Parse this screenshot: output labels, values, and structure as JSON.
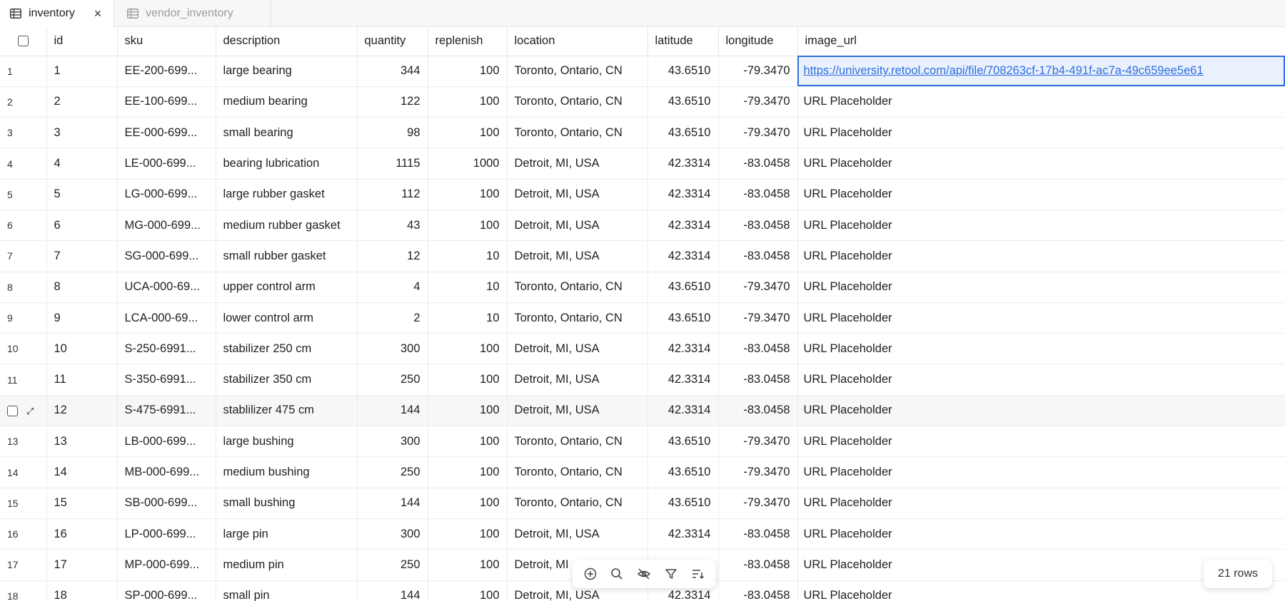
{
  "tabs": [
    {
      "label": "inventory",
      "active": true
    },
    {
      "label": "vendor_inventory",
      "active": false
    }
  ],
  "columns": [
    "id",
    "sku",
    "description",
    "quantity",
    "replenish",
    "location",
    "latitude",
    "longitude",
    "image_url"
  ],
  "rows": [
    {
      "n": "1",
      "id": "1",
      "sku": "EE-200-699...",
      "description": "large bearing",
      "quantity": "344",
      "replenish": "100",
      "location": "Toronto, Ontario, CN",
      "latitude": "43.6510",
      "longitude": "-79.3470",
      "image_url": "https://university.retool.com/api/file/708263cf-17b4-491f-ac7a-49c659ee5e61"
    },
    {
      "n": "2",
      "id": "2",
      "sku": "EE-100-699...",
      "description": "medium bearing",
      "quantity": "122",
      "replenish": "100",
      "location": "Toronto, Ontario, CN",
      "latitude": "43.6510",
      "longitude": "-79.3470",
      "image_url": "URL Placeholder"
    },
    {
      "n": "3",
      "id": "3",
      "sku": "EE-000-699...",
      "description": "small bearing",
      "quantity": "98",
      "replenish": "100",
      "location": "Toronto, Ontario, CN",
      "latitude": "43.6510",
      "longitude": "-79.3470",
      "image_url": "URL Placeholder"
    },
    {
      "n": "4",
      "id": "4",
      "sku": "LE-000-699...",
      "description": "bearing lubrication",
      "quantity": "1115",
      "replenish": "1000",
      "location": "Detroit, MI, USA",
      "latitude": "42.3314",
      "longitude": "-83.0458",
      "image_url": "URL Placeholder"
    },
    {
      "n": "5",
      "id": "5",
      "sku": "LG-000-699...",
      "description": "large rubber gasket",
      "quantity": "112",
      "replenish": "100",
      "location": "Detroit, MI, USA",
      "latitude": "42.3314",
      "longitude": "-83.0458",
      "image_url": "URL Placeholder"
    },
    {
      "n": "6",
      "id": "6",
      "sku": "MG-000-699...",
      "description": "medium rubber gasket",
      "quantity": "43",
      "replenish": "100",
      "location": "Detroit, MI, USA",
      "latitude": "42.3314",
      "longitude": "-83.0458",
      "image_url": "URL Placeholder"
    },
    {
      "n": "7",
      "id": "7",
      "sku": "SG-000-699...",
      "description": "small rubber gasket",
      "quantity": "12",
      "replenish": "10",
      "location": "Detroit, MI, USA",
      "latitude": "42.3314",
      "longitude": "-83.0458",
      "image_url": "URL Placeholder"
    },
    {
      "n": "8",
      "id": "8",
      "sku": "UCA-000-69...",
      "description": "upper control arm",
      "quantity": "4",
      "replenish": "10",
      "location": "Toronto, Ontario, CN",
      "latitude": "43.6510",
      "longitude": "-79.3470",
      "image_url": "URL Placeholder"
    },
    {
      "n": "9",
      "id": "9",
      "sku": "LCA-000-69...",
      "description": "lower control arm",
      "quantity": "2",
      "replenish": "10",
      "location": "Toronto, Ontario, CN",
      "latitude": "43.6510",
      "longitude": "-79.3470",
      "image_url": "URL Placeholder"
    },
    {
      "n": "10",
      "id": "10",
      "sku": "S-250-6991...",
      "description": "stabilizer 250 cm",
      "quantity": "300",
      "replenish": "100",
      "location": "Detroit, MI, USA",
      "latitude": "42.3314",
      "longitude": "-83.0458",
      "image_url": "URL Placeholder"
    },
    {
      "n": "11",
      "id": "11",
      "sku": "S-350-6991...",
      "description": "stabilizer 350 cm",
      "quantity": "250",
      "replenish": "100",
      "location": "Detroit, MI, USA",
      "latitude": "42.3314",
      "longitude": "-83.0458",
      "image_url": "URL Placeholder"
    },
    {
      "n": "",
      "id": "12",
      "sku": "S-475-6991...",
      "description": "stablilizer 475 cm",
      "quantity": "144",
      "replenish": "100",
      "location": "Detroit, MI, USA",
      "latitude": "42.3314",
      "longitude": "-83.0458",
      "image_url": "URL Placeholder"
    },
    {
      "n": "13",
      "id": "13",
      "sku": "LB-000-699...",
      "description": "large bushing",
      "quantity": "300",
      "replenish": "100",
      "location": "Toronto, Ontario, CN",
      "latitude": "43.6510",
      "longitude": "-79.3470",
      "image_url": "URL Placeholder"
    },
    {
      "n": "14",
      "id": "14",
      "sku": "MB-000-699...",
      "description": "medium bushing",
      "quantity": "250",
      "replenish": "100",
      "location": "Toronto, Ontario, CN",
      "latitude": "43.6510",
      "longitude": "-79.3470",
      "image_url": "URL Placeholder"
    },
    {
      "n": "15",
      "id": "15",
      "sku": "SB-000-699...",
      "description": "small bushing",
      "quantity": "144",
      "replenish": "100",
      "location": "Toronto, Ontario, CN",
      "latitude": "43.6510",
      "longitude": "-79.3470",
      "image_url": "URL Placeholder"
    },
    {
      "n": "16",
      "id": "16",
      "sku": "LP-000-699...",
      "description": "large pin",
      "quantity": "300",
      "replenish": "100",
      "location": "Detroit, MI, USA",
      "latitude": "42.3314",
      "longitude": "-83.0458",
      "image_url": "URL Placeholder"
    },
    {
      "n": "17",
      "id": "17",
      "sku": "MP-000-699...",
      "description": "medium pin",
      "quantity": "250",
      "replenish": "100",
      "location": "Detroit, MI",
      "latitude": "",
      "longitude": "-83.0458",
      "image_url": "URL Placeholder"
    },
    {
      "n": "18",
      "id": "18",
      "sku": "SP-000-699...",
      "description": "small pin",
      "quantity": "144",
      "replenish": "100",
      "location": "Detroit, MI, USA",
      "latitude": "42.3314",
      "longitude": "-83.0458",
      "image_url": "URL Placeholder"
    }
  ],
  "toolbar": {
    "icons": [
      "add-row-icon",
      "search-icon",
      "hide-columns-icon",
      "filter-icon",
      "sort-icon"
    ]
  },
  "row_count_label": "21 rows",
  "colors": {
    "accent": "#2f6fe0",
    "selected_bg": "#eaf1fd",
    "hover_bg": "#f7f7f7"
  }
}
